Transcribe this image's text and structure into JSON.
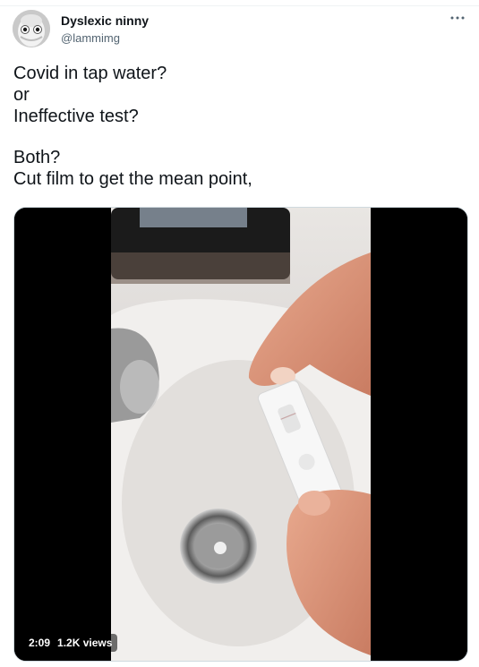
{
  "user": {
    "display_name": "Dyslexic ninny",
    "handle": "@lammimg"
  },
  "tweet": {
    "lines": [
      "Covid in tap water?",
      "or",
      "Ineffective test?",
      "",
      "Both?",
      "Cut film to get the mean point,"
    ]
  },
  "video": {
    "duration": "2:09",
    "views": "1.2K views"
  },
  "icons": {
    "more": "more-horizontal-icon"
  },
  "colors": {
    "text": "#0f1419",
    "secondary": "#536471",
    "media_bg": "#000000"
  }
}
